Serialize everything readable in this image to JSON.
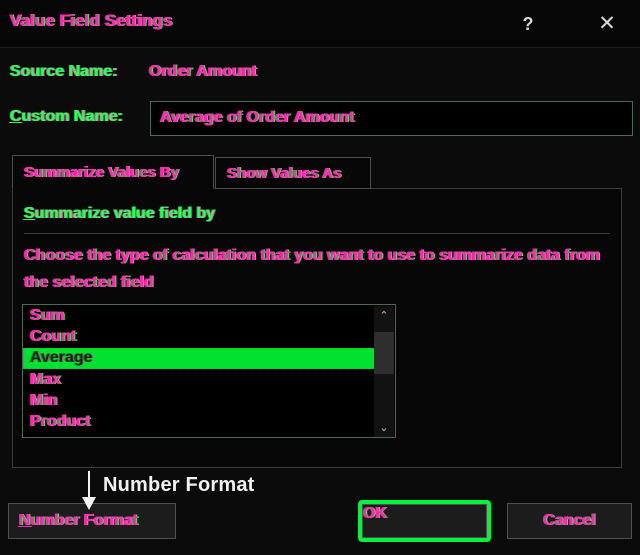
{
  "window": {
    "title": "Value Field Settings",
    "help_icon": "?",
    "help_icon_name": "help-icon",
    "close_icon": "✕",
    "close_icon_name": "close-icon"
  },
  "source": {
    "label": "Source Name:",
    "value": "Order Amount"
  },
  "custom": {
    "label_accel": "C",
    "label_rest": "ustom Name:",
    "value": "Average of Order Amount"
  },
  "tabs": [
    {
      "label": "Summarize Values By",
      "active": true
    },
    {
      "label": "Show Values As",
      "active": false
    }
  ],
  "panel": {
    "heading_accel": "S",
    "heading_rest": "ummarize value field by",
    "description": "Choose the type of calculation that you want to use to summarize data from the selected field"
  },
  "listbox": {
    "items": [
      {
        "label": "Sum",
        "selected": false
      },
      {
        "label": "Count",
        "selected": false
      },
      {
        "label": "Average",
        "selected": true
      },
      {
        "label": "Max",
        "selected": false
      },
      {
        "label": "Min",
        "selected": false
      },
      {
        "label": "Product",
        "selected": false
      }
    ],
    "scrollbar": {
      "up_arrow": "⌃",
      "down_arrow": "⌄"
    }
  },
  "buttons": {
    "number_format_accel": "N",
    "number_format_rest": "umber Format",
    "ok": "OK",
    "cancel": "Cancel"
  },
  "annotation": {
    "text": "Number Format"
  },
  "colors": {
    "highlight_green": "#00e22f",
    "focus_outline_green": "#00f53a",
    "text_fringe_magenta": "#ff27b8",
    "text_fringe_green": "#1eff44",
    "dialog_background": "#0b0b0b",
    "field_border": "#4a6a58",
    "annotation_white": "#f2f2f2"
  }
}
